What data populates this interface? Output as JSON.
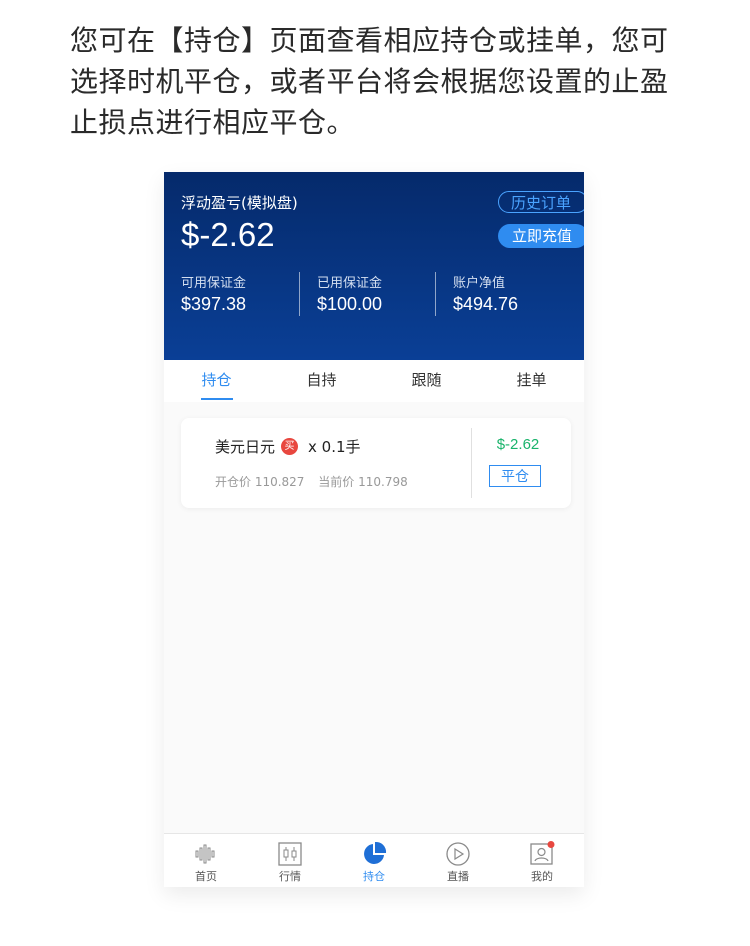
{
  "intro_text": "您可在【持仓】页面查看相应持仓或挂单，您可选择时机平仓，或者平台将会根据您设置的止盈止损点进行相应平仓。",
  "header": {
    "float_label": "浮动盈亏(模拟盘)",
    "float_value": "$-2.62",
    "history_button": "历史订单",
    "recharge_button": "立即充值",
    "stats": [
      {
        "label": "可用保证金",
        "value": "$397.38"
      },
      {
        "label": "已用保证金",
        "value": "$100.00"
      },
      {
        "label": "账户净值",
        "value": "$494.76"
      }
    ]
  },
  "tabs": [
    {
      "label": "持仓",
      "active": true
    },
    {
      "label": "自持",
      "active": false
    },
    {
      "label": "跟随",
      "active": false
    },
    {
      "label": "挂单",
      "active": false
    }
  ],
  "position": {
    "instrument": "美元日元",
    "side_badge": "买",
    "lots": "x 0.1手",
    "open_price": "开仓价 110.827",
    "current_price": "当前价 110.798",
    "pnl": "$-2.62",
    "close_button": "平仓"
  },
  "bottom_nav": [
    {
      "label": "首页",
      "icon": "waveform-icon",
      "active": false
    },
    {
      "label": "行情",
      "icon": "candlestick-icon",
      "active": false
    },
    {
      "label": "持仓",
      "icon": "pie-chart-icon",
      "active": true
    },
    {
      "label": "直播",
      "icon": "play-icon",
      "active": false
    },
    {
      "label": "我的",
      "icon": "profile-icon",
      "active": false
    }
  ],
  "colors": {
    "header_bg": "#0a3f96",
    "accent": "#2f8cf0",
    "profit_text": "#19b36b",
    "buy_badge": "#e8473f",
    "notification_dot": "#e8473f"
  }
}
